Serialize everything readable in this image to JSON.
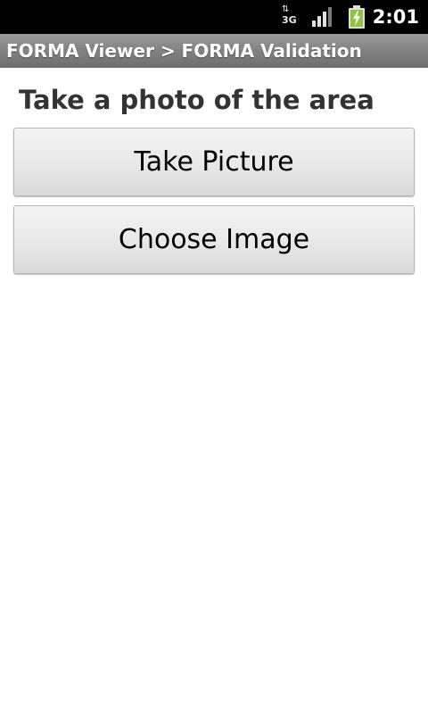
{
  "status_bar": {
    "network_type": "3G",
    "data_arrows": "⇅",
    "time": "2:01",
    "icons": [
      "data-activity-icon",
      "signal-strength-icon",
      "battery-charging-icon"
    ],
    "colors": {
      "background": "#000000",
      "battery_fill": "#8cc63f"
    }
  },
  "title_bar": {
    "title": "FORMA Viewer > FORMA Validation"
  },
  "main": {
    "prompt": "Take a photo of the area",
    "take_picture_label": "Take Picture",
    "choose_image_label": "Choose Image"
  }
}
